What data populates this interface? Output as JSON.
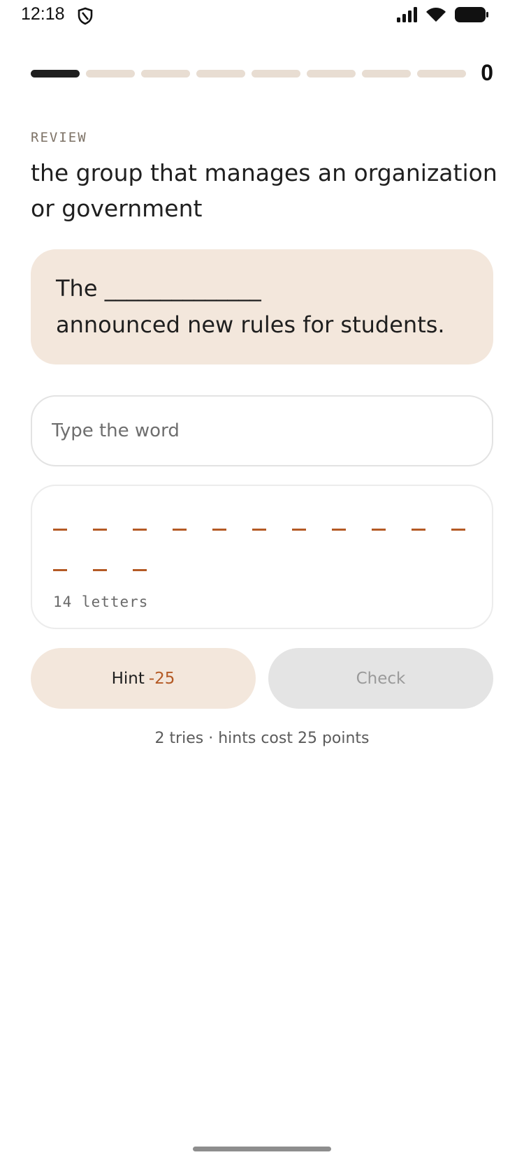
{
  "status_bar": {
    "time": "12:18",
    "icons": [
      "shield-icon",
      "signal-icon",
      "wifi-icon",
      "battery-icon"
    ]
  },
  "progress": {
    "total_segments": 8,
    "completed": 1,
    "score": "0"
  },
  "quiz": {
    "mode_label": "REVIEW",
    "definition": "the group that manages an organization or government",
    "sentence_before": "The ",
    "sentence_blank": "______________",
    "sentence_after": "announced new rules for students.",
    "input_placeholder": "Type the word",
    "letter_count": 14,
    "letters_label": "14 letters"
  },
  "actions": {
    "hint_label": "Hint",
    "hint_cost": "-25",
    "check_label": "Check"
  },
  "footer_note": "2 tries · hints cost 25 points",
  "colors": {
    "accent": "#b45a25",
    "card_bg": "#f3e7dc",
    "progress_inactive": "#e8ddd2",
    "progress_active": "#1f1f1f"
  }
}
